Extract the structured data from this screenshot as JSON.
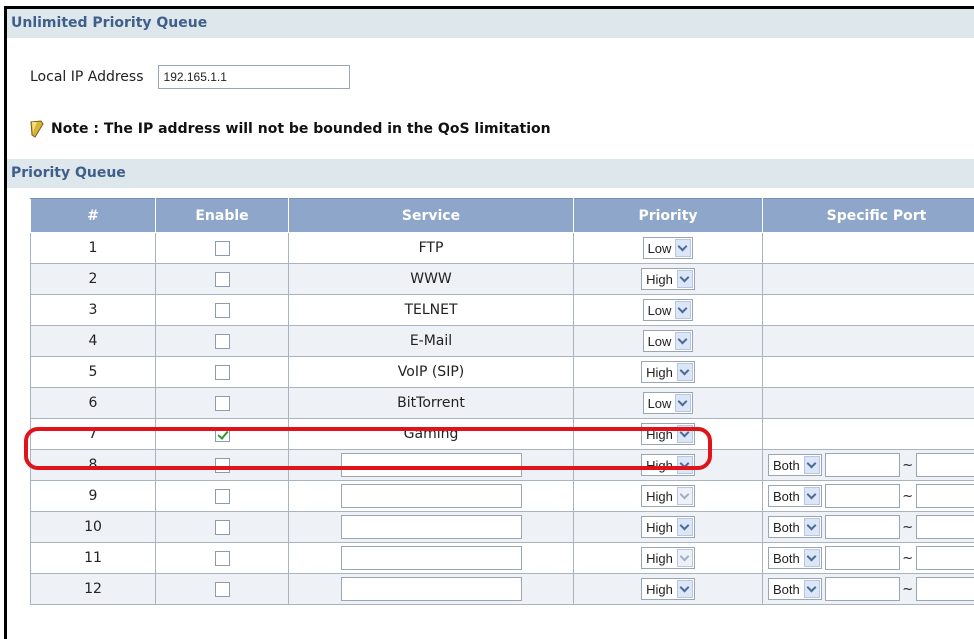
{
  "sections": {
    "unlimited_title": "Unlimited Priority Queue",
    "priority_title": "Priority Queue"
  },
  "local_ip": {
    "label": "Local IP Address",
    "value": "192.165.1.1"
  },
  "note": {
    "text": "Note : The IP address will not be bounded in the QoS limitation",
    "icon": "note-pencil-icon"
  },
  "table": {
    "headers": [
      "#",
      "Enable",
      "Service",
      "Priority",
      "Specific Port"
    ],
    "rows": [
      {
        "num": "1",
        "enabled": false,
        "service": "FTP",
        "priority": "Low"
      },
      {
        "num": "2",
        "enabled": false,
        "service": "WWW",
        "priority": "High"
      },
      {
        "num": "3",
        "enabled": false,
        "service": "TELNET",
        "priority": "Low"
      },
      {
        "num": "4",
        "enabled": false,
        "service": "E-Mail",
        "priority": "Low"
      },
      {
        "num": "5",
        "enabled": false,
        "service": "VoIP (SIP)",
        "priority": "High"
      },
      {
        "num": "6",
        "enabled": false,
        "service": "BitTorrent",
        "priority": "Low"
      },
      {
        "num": "7",
        "enabled": true,
        "service": "Gaming",
        "priority": "High"
      },
      {
        "num": "8",
        "enabled": false,
        "service": "",
        "priority": "High",
        "protocol": "Both"
      },
      {
        "num": "9",
        "enabled": false,
        "service": "",
        "priority": "High",
        "protocol": "Both"
      },
      {
        "num": "10",
        "enabled": false,
        "service": "",
        "priority": "High",
        "protocol": "Both"
      },
      {
        "num": "11",
        "enabled": false,
        "service": "",
        "priority": "High",
        "protocol": "Both"
      },
      {
        "num": "12",
        "enabled": false,
        "service": "",
        "priority": "High",
        "protocol": "Both"
      }
    ],
    "port_separator": "~"
  },
  "colors": {
    "section_bar": "#dde7ec",
    "section_text": "#3f5f8a",
    "header_bg": "#8ea6c9",
    "highlight": "#e0131a"
  }
}
